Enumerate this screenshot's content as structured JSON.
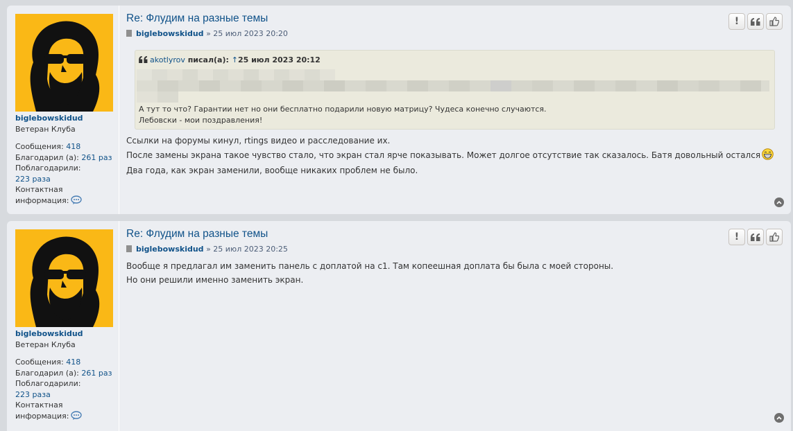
{
  "posts": [
    {
      "title": "Re: Флудим на разные темы",
      "author": "biglebowskidud",
      "date": "» 25 июл 2023 20:20",
      "profile": {
        "username": "biglebowskidud",
        "rank": "Ветеран Клуба",
        "posts_label": "Сообщения:",
        "posts_value": "418",
        "thanked_label": "Благодарил (а):",
        "thanked_value": "261 раз",
        "thanks_label": "Поблагодарили:",
        "thanks_value": "223 раза",
        "contact_label1": "Контактная",
        "contact_label2": "информация:"
      },
      "quote": {
        "author": "akotlyrov",
        "wrote": "писал(а):",
        "arrow": "↑",
        "date": "25 июл 2023 20:12",
        "lines": [
          "А тут то что? Гарантии нет но они бесплатно подарили новую матрицу? Чудеса конечно случаются.",
          "Лебовски - мои поздравления!"
        ]
      },
      "body": [
        "Ссылки на форумы кинул, rtings видео и расследование их.",
        "После замены экрана такое чувство стало, что экран стал ярче показывать. Может долгое отсутствие так сказалось. Батя довольный остался",
        "Два года, как экран заменили, вообще никаких проблем не было."
      ]
    },
    {
      "title": "Re: Флудим на разные темы",
      "author": "biglebowskidud",
      "date": "» 25 июл 2023 20:25",
      "profile": {
        "username": "biglebowskidud",
        "rank": "Ветеран Клуба",
        "posts_label": "Сообщения:",
        "posts_value": "418",
        "thanked_label": "Благодарил (а):",
        "thanked_value": "261 раз",
        "thanks_label": "Поблагодарили:",
        "thanks_value": "223 раза",
        "contact_label1": "Контактная",
        "contact_label2": "информация:"
      },
      "body": [
        "Вообще я предлагал им заменить панель с доплатой на с1. Там копеешная доплата бы была с моей стороны.",
        "Но они решили именно заменить экран."
      ]
    }
  ],
  "actions": {
    "report": "!",
    "quote_icon": "quote-icon",
    "like_icon": "thumbs-up-icon"
  },
  "colors": {
    "link": "#105289",
    "post_bg": "#eceef2",
    "quote_bg": "#ebeadd",
    "avatar_bg": "#fab816"
  }
}
